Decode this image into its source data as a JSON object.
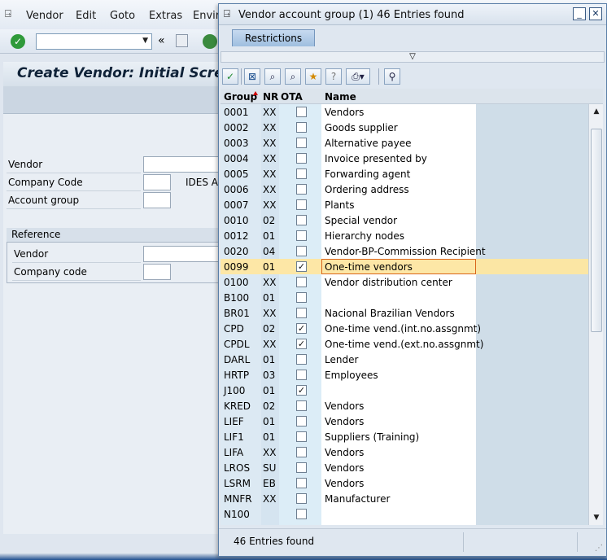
{
  "main": {
    "menu": [
      "Vendor",
      "Edit",
      "Goto",
      "Extras",
      "Enviro"
    ],
    "title": "Create Vendor:  Initial Screen",
    "fields": {
      "vendor_label": "Vendor",
      "company_code_label": "Company Code",
      "company_code_desc": "IDES A",
      "account_group_label": "Account group"
    },
    "reference": {
      "title": "Reference",
      "vendor_label": "Vendor",
      "company_code_label": "Company code"
    }
  },
  "dialog": {
    "title": "Vendor account group (1)   46 Entries found",
    "tab": "Restrictions",
    "columns": [
      "Group",
      "NR",
      "OTA",
      "Name"
    ],
    "rows": [
      {
        "group": "0001",
        "nr": "XX",
        "ota": "",
        "name": "Vendors"
      },
      {
        "group": "0002",
        "nr": "XX",
        "ota": "",
        "name": "Goods supplier"
      },
      {
        "group": "0003",
        "nr": "XX",
        "ota": "",
        "name": "Alternative payee"
      },
      {
        "group": "0004",
        "nr": "XX",
        "ota": "",
        "name": "Invoice presented by"
      },
      {
        "group": "0005",
        "nr": "XX",
        "ota": "",
        "name": "Forwarding agent"
      },
      {
        "group": "0006",
        "nr": "XX",
        "ota": "",
        "name": "Ordering address"
      },
      {
        "group": "0007",
        "nr": "XX",
        "ota": "",
        "name": "Plants"
      },
      {
        "group": "0010",
        "nr": "02",
        "ota": "",
        "name": "Special vendor"
      },
      {
        "group": "0012",
        "nr": "01",
        "ota": "",
        "name": "Hierarchy nodes"
      },
      {
        "group": "0020",
        "nr": "04",
        "ota": "",
        "name": "Vendor-BP-Commission Recipient"
      },
      {
        "group": "0099",
        "nr": "01",
        "ota": "✓",
        "name": "One-time vendors",
        "selected": true
      },
      {
        "group": "0100",
        "nr": "XX",
        "ota": "",
        "name": "Vendor distribution center"
      },
      {
        "group": "B100",
        "nr": "01",
        "ota": "",
        "name": ""
      },
      {
        "group": "BR01",
        "nr": "XX",
        "ota": "",
        "name": "Nacional Brazilian Vendors"
      },
      {
        "group": "CPD",
        "nr": "02",
        "ota": "✓",
        "name": "One-time vend.(int.no.assgnmt)"
      },
      {
        "group": "CPDL",
        "nr": "XX",
        "ota": "✓",
        "name": "One-time vend.(ext.no.assgnmt)"
      },
      {
        "group": "DARL",
        "nr": "01",
        "ota": "",
        "name": "Lender"
      },
      {
        "group": "HRTP",
        "nr": "03",
        "ota": "",
        "name": "Employees"
      },
      {
        "group": "J100",
        "nr": "01",
        "ota": "✓",
        "name": ""
      },
      {
        "group": "KRED",
        "nr": "02",
        "ota": "",
        "name": "Vendors"
      },
      {
        "group": "LIEF",
        "nr": "01",
        "ota": "",
        "name": "Vendors"
      },
      {
        "group": "LIF1",
        "nr": "01",
        "ota": "",
        "name": "Suppliers (Training)"
      },
      {
        "group": "LIFA",
        "nr": "XX",
        "ota": "",
        "name": "Vendors"
      },
      {
        "group": "LROS",
        "nr": "SU",
        "ota": "",
        "name": "Vendors"
      },
      {
        "group": "LSRM",
        "nr": "EB",
        "ota": "",
        "name": "Vendors"
      },
      {
        "group": "MNFR",
        "nr": "XX",
        "ota": "",
        "name": "Manufacturer"
      },
      {
        "group": "N100",
        "nr": "",
        "ota": "",
        "name": ""
      }
    ],
    "status": "46 Entries found"
  }
}
